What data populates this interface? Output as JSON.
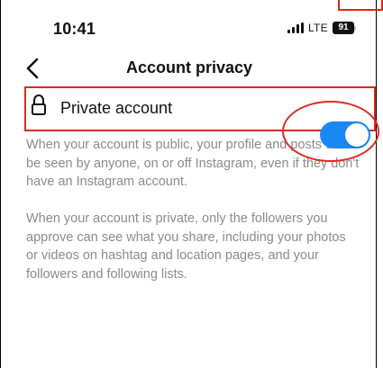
{
  "status_bar": {
    "time": "10:41",
    "network": "LTE",
    "battery": "91"
  },
  "header": {
    "title": "Account privacy"
  },
  "settings": {
    "private_account_label": "Private account",
    "private_account_enabled": true,
    "toggle_color": "#1a88f4"
  },
  "descriptions": {
    "public_text": "When your account is public, your profile and posts can be seen by anyone, on or off Instagram, even if they don't have an Instagram account.",
    "private_text": "When your account is private, only the followers you approve can see what you share, including your photos or videos on hashtag and location pages, and your followers and following lists."
  },
  "annotation_color": "#df2a22"
}
